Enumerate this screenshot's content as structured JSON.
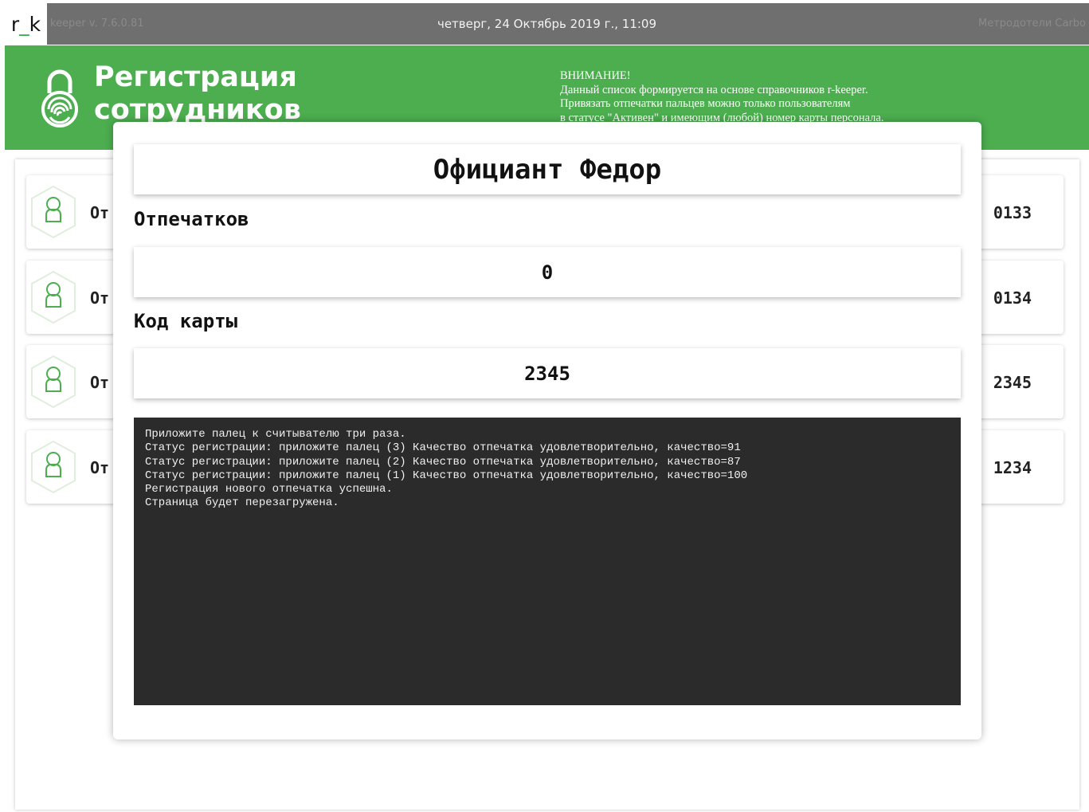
{
  "topbar": {
    "logo_left": "r",
    "logo_mid": "_",
    "logo_right": "k",
    "version": "keeper v. 7.6.0.81",
    "datetime": "четверг, 24 Октябрь 2019 г., 11:09",
    "user": "Метродотели Carbo"
  },
  "header": {
    "title": "Регистрация сотрудников",
    "notice": "ВНИМАНИЕ!\nДанный список формируется на основе справочников r-keeper.\nПривязать отпечатки пальцев можно только пользователям\nв статусе \"Активен\" и имеющим (любой) номер карты персонала."
  },
  "employees": [
    {
      "name": "От",
      "code": "0133"
    },
    {
      "name": "От",
      "code": "0134"
    },
    {
      "name": "От",
      "code": "2345"
    },
    {
      "name": "От",
      "code": "1234"
    }
  ],
  "modal": {
    "employee_name": "Официант Федор",
    "fingerprints_label": "Отпечатков",
    "fingerprints_value": "0",
    "card_code_label": "Код карты",
    "card_code_value": "2345",
    "console_lines": [
      "Приложите палец к считывателю три раза.",
      "Статус регистрации: приложите палец (3) Качество отпечатка удовлетворительно, качество=91",
      "Статус регистрации: приложите палец (2) Качество отпечатка удовлетворительно, качество=87",
      "Статус регистрации: приложите палец (1) Качество отпечатка удовлетворительно, качество=100",
      "Регистрация нового отпечатка успешна.",
      "Страница будет перезагружена."
    ]
  },
  "colors": {
    "brand_green": "#4cae4f",
    "topbar_gray": "#6f6f6f",
    "console_bg": "#2b2b2b"
  }
}
